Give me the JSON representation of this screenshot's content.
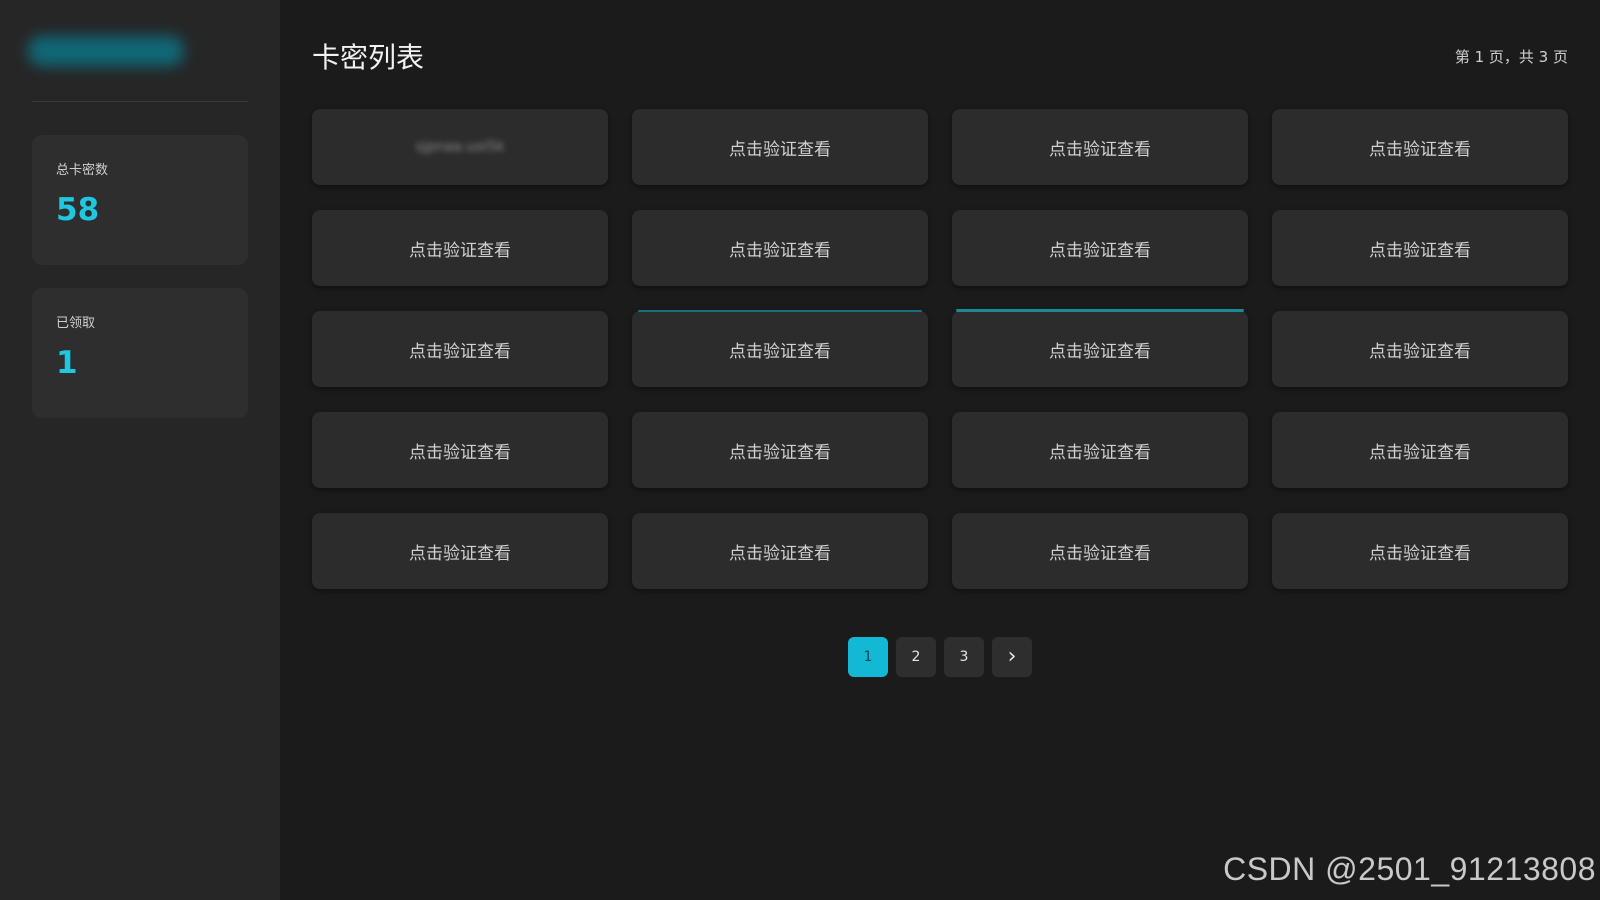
{
  "sidebar": {
    "stats": [
      {
        "label": "总卡密数",
        "value": "58"
      },
      {
        "label": "已领取",
        "value": "1"
      }
    ]
  },
  "main": {
    "title": "卡密列表",
    "page_info": "第 1 页，共 3 页",
    "cards": [
      {
        "label": "",
        "revealed": true
      },
      {
        "label": "点击验证查看"
      },
      {
        "label": "点击验证查看"
      },
      {
        "label": "点击验证查看"
      },
      {
        "label": "点击验证查看"
      },
      {
        "label": "点击验证查看"
      },
      {
        "label": "点击验证查看"
      },
      {
        "label": "点击验证查看"
      },
      {
        "label": "点击验证查看"
      },
      {
        "label": "点击验证查看"
      },
      {
        "label": "点击验证查看"
      },
      {
        "label": "点击验证查看"
      },
      {
        "label": "点击验证查看"
      },
      {
        "label": "点击验证查看"
      },
      {
        "label": "点击验证查看"
      },
      {
        "label": "点击验证查看"
      },
      {
        "label": "点击验证查看"
      },
      {
        "label": "点击验证查看"
      },
      {
        "label": "点击验证查看"
      },
      {
        "label": "点击验证查看"
      }
    ]
  },
  "pagination": {
    "pages": [
      "1",
      "2",
      "3"
    ],
    "current": "1",
    "next_icon": "chevron-right-icon",
    "next_glyph": "›"
  },
  "watermark": "CSDN @2501_91213808",
  "colors": {
    "accent": "#1ec8e0",
    "active_page": "#12b8d4",
    "background": "#1b1b1b",
    "sidebar": "#262626",
    "card": "#2c2c2c"
  }
}
